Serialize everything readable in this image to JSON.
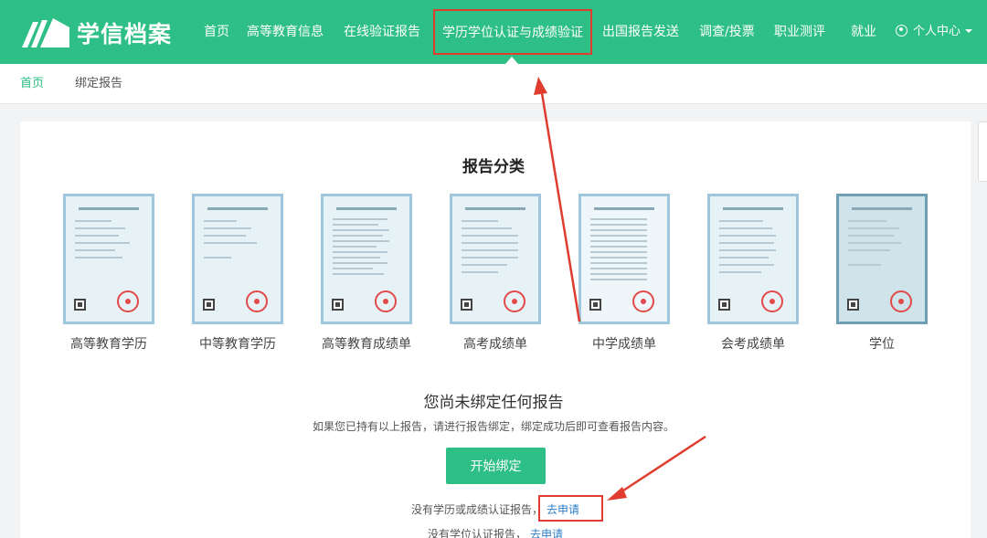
{
  "header": {
    "logo_text": "学信档案",
    "nav": [
      {
        "label": "首页"
      },
      {
        "label": "高等教育信息"
      },
      {
        "label": "在线验证报告"
      },
      {
        "label": "学历学位认证与成绩验证"
      },
      {
        "label": "出国报告发送"
      },
      {
        "label": "调查/投票"
      },
      {
        "label": "职业测评"
      },
      {
        "label": "就业"
      }
    ],
    "user_center": "个人中心",
    "brand_color": "#2dbf85"
  },
  "breadcrumb": {
    "home": "首页",
    "current": "绑定报告"
  },
  "main": {
    "section_title": "报告分类",
    "reports": [
      {
        "label": "高等教育学历"
      },
      {
        "label": "中等教育学历"
      },
      {
        "label": "高等教育成绩单"
      },
      {
        "label": "高考成绩单"
      },
      {
        "label": "中学成绩单"
      },
      {
        "label": "会考成绩单"
      },
      {
        "label": "学位"
      }
    ],
    "empty_title": "您尚未绑定任何报告",
    "empty_desc": "如果您已持有以上报告，请进行报告绑定，绑定成功后即可查看报告内容。",
    "bind_button": "开始绑定",
    "no_report_1": "没有学历或成绩认证报告，",
    "apply_1": "去申请",
    "no_report_2": "没有学位认证报告，",
    "apply_2": "去申请"
  },
  "icons": {
    "logo": "book-icon",
    "user": "user-circle-icon",
    "caret": "caret-down-icon"
  },
  "annotation_color": "#e03c2f"
}
